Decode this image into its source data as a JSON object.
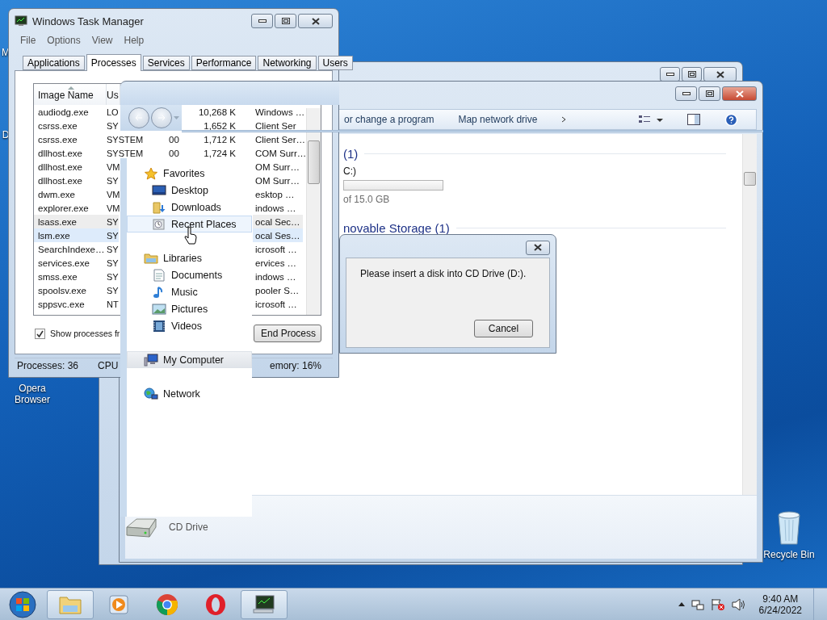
{
  "desktop_icons": [
    {
      "label": "M",
      "kind": "label"
    },
    {
      "label": "D",
      "kind": "label"
    },
    {
      "label": "Opera Browser",
      "kind": "label"
    },
    {
      "label": "Recycle Bin",
      "kind": "icon"
    }
  ],
  "task_manager": {
    "title": "Windows Task Manager",
    "menu": [
      "File",
      "Options",
      "View",
      "Help"
    ],
    "tabs": [
      {
        "label": "Applications",
        "selected": false
      },
      {
        "label": "Processes",
        "selected": true
      },
      {
        "label": "Services",
        "selected": false
      },
      {
        "label": "Performance",
        "selected": false
      },
      {
        "label": "Networking",
        "selected": false
      },
      {
        "label": "Users",
        "selected": false
      }
    ],
    "columns": [
      "Image Name",
      "Us"
    ],
    "rows": [
      {
        "name": "audiodg.exe",
        "user": "LO",
        "memory": "10,268 K",
        "description": "Windows …",
        "selected": false,
        "hovered": false
      },
      {
        "name": "csrss.exe",
        "user": "SY",
        "memory": "1,652 K",
        "description": "Client Ser",
        "selected": false,
        "hovered": false
      },
      {
        "name": "csrss.exe",
        "user": "SYSTEM",
        "cpu": "00",
        "memory": "1,712 K",
        "description": "Client Ser…",
        "selected": false,
        "hovered": false
      },
      {
        "name": "dllhost.exe",
        "user": "SYSTEM",
        "cpu": "00",
        "memory": "1,724 K",
        "description": "COM Surr…",
        "selected": false,
        "hovered": false
      },
      {
        "name": "dllhost.exe",
        "user": "VM",
        "description": "OM Surr…",
        "selected": false,
        "hovered": false
      },
      {
        "name": "dllhost.exe",
        "user": "SY",
        "description": "OM Surr…",
        "selected": false,
        "hovered": false
      },
      {
        "name": "dwm.exe",
        "user": "VM",
        "description": "esktop …",
        "selected": false,
        "hovered": false
      },
      {
        "name": "explorer.exe",
        "user": "VM",
        "description": "indows …",
        "selected": false,
        "hovered": false
      },
      {
        "name": "lsass.exe",
        "user": "SY",
        "description": "ocal Sec…",
        "selected": false,
        "hovered": true
      },
      {
        "name": "lsm.exe",
        "user": "SY",
        "description": "ocal Ses…",
        "selected": true,
        "hovered": false
      },
      {
        "name": "SearchIndexe…",
        "user": "SY",
        "description": "icrosoft …",
        "selected": false,
        "hovered": false
      },
      {
        "name": "services.exe",
        "user": "SY",
        "description": "ervices …",
        "selected": false,
        "hovered": false
      },
      {
        "name": "smss.exe",
        "user": "SY",
        "description": "indows …",
        "selected": false,
        "hovered": false
      },
      {
        "name": "spoolsv.exe",
        "user": "SY",
        "description": "pooler S…",
        "selected": false,
        "hovered": false
      },
      {
        "name": "sppsvc.exe",
        "user": "NT",
        "description": "icrosoft …",
        "selected": false,
        "hovered": false
      }
    ],
    "show_processes": {
      "label": "Show processes fr",
      "checked": true
    },
    "end_button": "End Process",
    "status": [
      "Processes: 36",
      "CPU",
      "emory: 16%"
    ]
  },
  "explorer": {
    "toolbar": [
      "or change a program",
      "Map network drive"
    ],
    "groups": [
      {
        "title": "(1)",
        "drives": [
          {
            "label": "C:)",
            "detail": "of 15.0 GB"
          }
        ]
      },
      {
        "title": "novable Storage (1)"
      }
    ],
    "details": {
      "label": "CD Drive"
    },
    "nav": [
      {
        "label": "Favorites",
        "selected": false,
        "hovered": false,
        "children": [
          {
            "label": "Desktop",
            "selected": false,
            "hovered": false
          },
          {
            "label": "Downloads",
            "selected": false,
            "hovered": false
          },
          {
            "label": "Recent Places",
            "selected": false,
            "hovered": true
          }
        ]
      },
      {
        "label": "Libraries",
        "selected": false,
        "hovered": false,
        "children": [
          {
            "label": "Documents",
            "selected": false,
            "hovered": false
          },
          {
            "label": "Music",
            "selected": false,
            "hovered": false
          },
          {
            "label": "Pictures",
            "selected": false,
            "hovered": false
          },
          {
            "label": "Videos",
            "selected": false,
            "hovered": false
          }
        ]
      },
      {
        "label": "My Computer",
        "selected": true,
        "hovered": false
      },
      {
        "label": "Network",
        "selected": false,
        "hovered": false
      }
    ]
  },
  "dialog": {
    "message": "Please insert a disk into CD Drive (D:).",
    "button": "Cancel"
  },
  "taskbar": {
    "items": [
      {
        "active": true
      },
      {
        "active": false
      },
      {
        "active": false
      },
      {
        "active": false
      },
      {
        "active": true
      }
    ],
    "time": "9:40 AM",
    "date": "6/24/2022"
  }
}
